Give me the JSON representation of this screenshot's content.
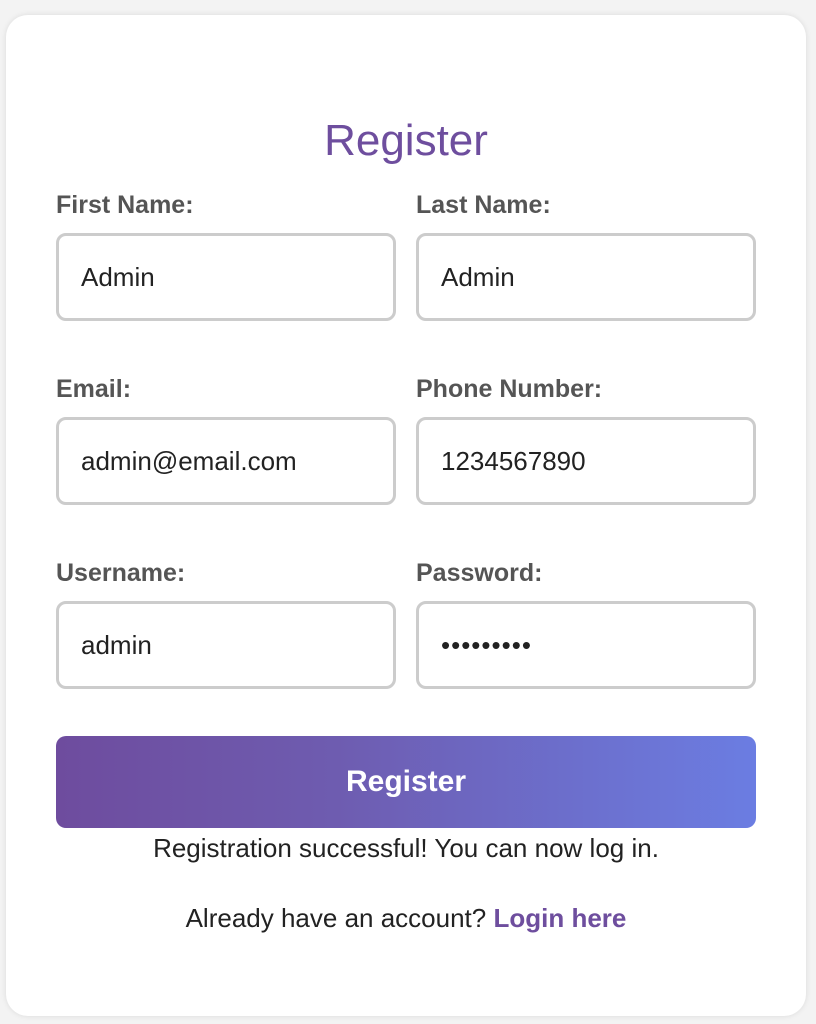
{
  "form": {
    "title": "Register",
    "first_name": {
      "label": "First Name:",
      "value": "Admin"
    },
    "last_name": {
      "label": "Last Name:",
      "value": "Admin"
    },
    "email": {
      "label": "Email:",
      "value": "admin@email.com"
    },
    "phone": {
      "label": "Phone Number:",
      "value": "1234567890"
    },
    "username": {
      "label": "Username:",
      "value": "admin"
    },
    "password": {
      "label": "Password:",
      "value": "password1"
    },
    "submit_label": "Register",
    "status_message": "Registration successful! You can now log in.",
    "footer_prompt": "Already have an account?",
    "login_link": "Login here"
  },
  "colors": {
    "accent": "#6e4e9e",
    "gradient_start": "#6e4c9e",
    "gradient_end": "#6b7de2",
    "label": "#555555",
    "input_border": "#cccccc"
  }
}
